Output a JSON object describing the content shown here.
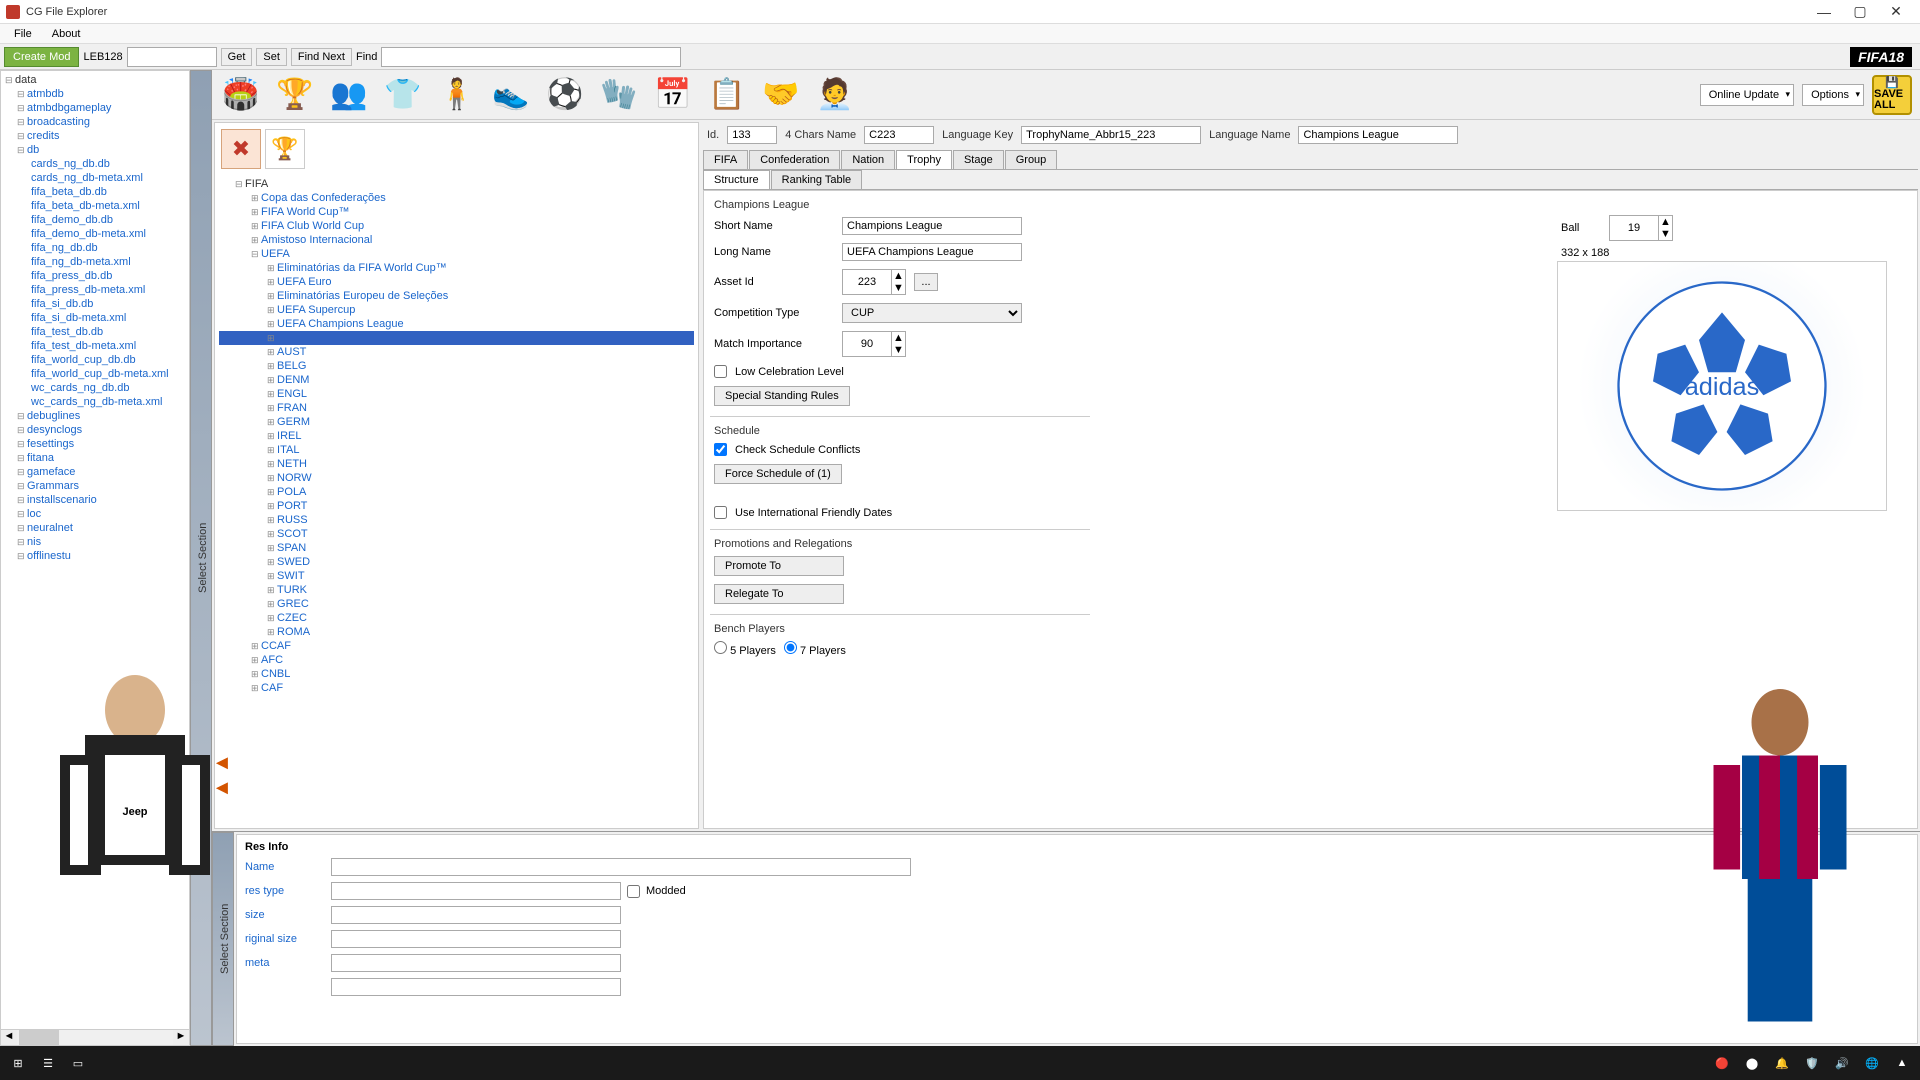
{
  "window": {
    "title": "CG File Explorer"
  },
  "menu": {
    "file": "File",
    "about": "About"
  },
  "toolbar": {
    "create_mod": "Create Mod",
    "leb": "LEB128",
    "get": "Get",
    "set": "Set",
    "find_next": "Find Next",
    "find": "Find",
    "logo": "FIFA18"
  },
  "left_tree": {
    "root": "data",
    "items": [
      "atmbdb",
      "atmbdbgameplay",
      "broadcasting",
      "credits",
      "db",
      "cards_ng_db.db",
      "cards_ng_db-meta.xml",
      "fifa_beta_db.db",
      "fifa_beta_db-meta.xml",
      "fifa_demo_db.db",
      "fifa_demo_db-meta.xml",
      "fifa_ng_db.db",
      "fifa_ng_db-meta.xml",
      "fifa_press_db.db",
      "fifa_press_db-meta.xml",
      "fifa_si_db.db",
      "fifa_si_db-meta.xml",
      "fifa_test_db.db",
      "fifa_test_db-meta.xml",
      "fifa_world_cup_db.db",
      "fifa_world_cup_db-meta.xml",
      "wc_cards_ng_db.db",
      "wc_cards_ng_db-meta.xml",
      "debuglines",
      "desynclogs",
      "fesettings",
      "fitana",
      "gameface",
      "Grammars",
      "installscenario",
      "loc",
      "neuralnet",
      "nis",
      "offlinestu"
    ]
  },
  "side_label": "Select Section",
  "iconbar": {
    "online_update": "Online Update",
    "options": "Options",
    "saveall": "SAVE ALL"
  },
  "trophy_tree": {
    "root": "FIFA",
    "items": [
      {
        "t": "Copa das Confederações",
        "lvl": 2
      },
      {
        "t": "FIFA World Cup™",
        "lvl": 2
      },
      {
        "t": "FIFA Club World Cup",
        "lvl": 2
      },
      {
        "t": "Amistoso Internacional",
        "lvl": 2
      },
      {
        "t": "UEFA",
        "lvl": 2,
        "open": true
      },
      {
        "t": "Eliminatórias da FIFA World Cup™",
        "lvl": 3
      },
      {
        "t": "UEFA Euro",
        "lvl": 3
      },
      {
        "t": "Eliminatórias Europeu de Seleções",
        "lvl": 3
      },
      {
        "t": "UEFA Supercup",
        "lvl": 3
      },
      {
        "t": "UEFA Champions League",
        "lvl": 3
      },
      {
        "t": "",
        "lvl": 3,
        "sel": true
      },
      {
        "t": "AUST",
        "lvl": 3
      },
      {
        "t": "BELG",
        "lvl": 3
      },
      {
        "t": "DENM",
        "lvl": 3
      },
      {
        "t": "ENGL",
        "lvl": 3
      },
      {
        "t": "FRAN",
        "lvl": 3
      },
      {
        "t": "GERM",
        "lvl": 3
      },
      {
        "t": "IREL",
        "lvl": 3
      },
      {
        "t": "ITAL",
        "lvl": 3
      },
      {
        "t": "NETH",
        "lvl": 3
      },
      {
        "t": "NORW",
        "lvl": 3
      },
      {
        "t": "POLA",
        "lvl": 3
      },
      {
        "t": "PORT",
        "lvl": 3
      },
      {
        "t": "RUSS",
        "lvl": 3
      },
      {
        "t": "SCOT",
        "lvl": 3
      },
      {
        "t": "SPAN",
        "lvl": 3
      },
      {
        "t": "SWED",
        "lvl": 3
      },
      {
        "t": "SWIT",
        "lvl": 3
      },
      {
        "t": "TURK",
        "lvl": 3
      },
      {
        "t": "GREC",
        "lvl": 3
      },
      {
        "t": "CZEC",
        "lvl": 3
      },
      {
        "t": "ROMA",
        "lvl": 3
      },
      {
        "t": "CCAF",
        "lvl": 2
      },
      {
        "t": "AFC",
        "lvl": 2
      },
      {
        "t": "CNBL",
        "lvl": 2
      },
      {
        "t": "CAF",
        "lvl": 2
      }
    ]
  },
  "id_row": {
    "id_lbl": "Id.",
    "id_val": "133",
    "chars_lbl": "4 Chars Name",
    "chars_val": "C223",
    "langkey_lbl": "Language Key",
    "langkey_val": "TrophyName_Abbr15_223",
    "langname_lbl": "Language Name",
    "langname_val": "Champions League"
  },
  "tabs": {
    "t1": "FIFA",
    "t2": "Confederation",
    "t3": "Nation",
    "t4": "Trophy",
    "t5": "Stage",
    "t6": "Group"
  },
  "subtabs": {
    "s1": "Structure",
    "s2": "Ranking Table"
  },
  "form": {
    "heading": "Champions League",
    "short_lbl": "Short Name",
    "short_val": "Champions League",
    "long_lbl": "Long Name",
    "long_val": "UEFA Champions League",
    "asset_lbl": "Asset Id",
    "asset_val": "223",
    "comp_lbl": "Competition Type",
    "comp_val": "CUP",
    "match_lbl": "Match Importance",
    "match_val": "90",
    "lowceleb": "Low Celebration Level",
    "spstanding": "Special Standing Rules",
    "schedule": "Schedule",
    "checksched": "Check Schedule Conflicts",
    "forcesched": "Force Schedule of (1)",
    "usefriendly": "Use International Friendly Dates",
    "promrel": "Promotions and Relegations",
    "promote": "Promote To",
    "relegate": "Relegate To",
    "bench": "Bench Players",
    "p5": "5 Players",
    "p7": "7 Players",
    "ball_lbl": "Ball",
    "ball_val": "19",
    "ball_dim": "332 x 188"
  },
  "res_info": {
    "title": "Res Info",
    "name": "Name",
    "restype": "res type",
    "size": "size",
    "origsize": "riginal size",
    "meta": "meta",
    "modded": "Modded"
  }
}
